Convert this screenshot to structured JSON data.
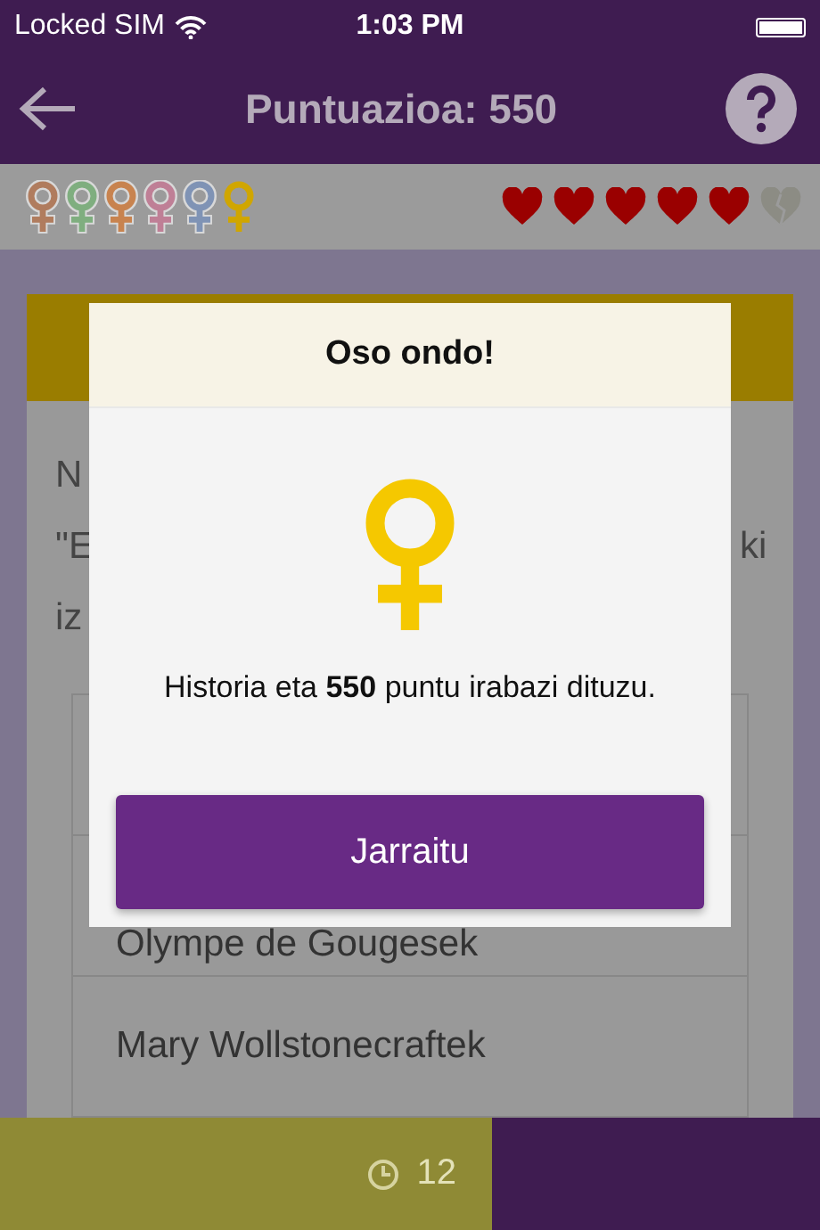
{
  "status_bar": {
    "carrier": "Locked SIM",
    "time": "1:03 PM"
  },
  "header": {
    "title": "Puntuazioa: 550"
  },
  "symbols": [
    {
      "color": "#b07c5e",
      "earned": false
    },
    {
      "color": "#7fae7f",
      "earned": false
    },
    {
      "color": "#c8834f",
      "earned": false
    },
    {
      "color": "#bf7f96",
      "earned": false
    },
    {
      "color": "#7f93b5",
      "earned": false
    },
    {
      "color": "#d0a600",
      "earned": true
    }
  ],
  "hearts": [
    {
      "filled": true
    },
    {
      "filled": true
    },
    {
      "filled": true
    },
    {
      "filled": true
    },
    {
      "filled": true
    },
    {
      "filled": false
    }
  ],
  "question": {
    "lines": [
      {
        "left": "N"
      },
      {
        "left": "\"E",
        "right": "ki"
      },
      {
        "left": "iz"
      }
    ]
  },
  "answers": [
    "Olympe de Gougesek",
    "Mary Wollstonecraftek"
  ],
  "timer": {
    "value": "12"
  },
  "modal": {
    "title": "Oso ondo!",
    "message": "Historia eta **550** puntu irabazi dituzu.",
    "button": "Jarraitu"
  }
}
